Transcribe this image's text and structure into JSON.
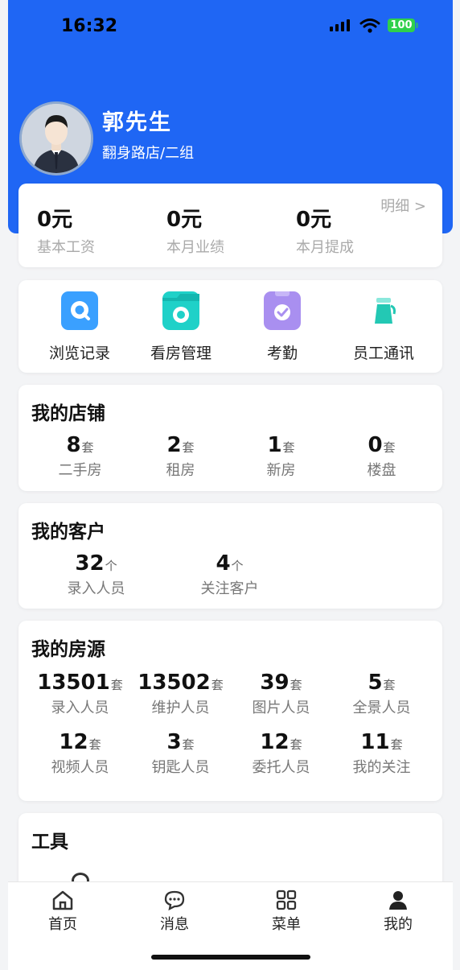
{
  "status_bar": {
    "time": "16:32",
    "battery": "100"
  },
  "profile": {
    "name": "郭先生",
    "store": "翻身路店/二组"
  },
  "salary": {
    "detail_label": "明细 >",
    "items": [
      {
        "value": "0元",
        "label": "基本工资"
      },
      {
        "value": "0元",
        "label": "本月业绩"
      },
      {
        "value": "0元",
        "label": "本月提成"
      }
    ]
  },
  "quick_actions": [
    {
      "label": "浏览记录",
      "icon": "search-bubble-icon",
      "color": "#3aa0ff"
    },
    {
      "label": "看房管理",
      "icon": "folder-camera-icon",
      "color": "#1fd1c8"
    },
    {
      "label": "考勤",
      "icon": "clipboard-check-icon",
      "color": "#a98ff0"
    },
    {
      "label": "员工通讯",
      "icon": "tie-icon",
      "color": "#23c8b4"
    }
  ],
  "shops": {
    "title": "我的店铺",
    "items": [
      {
        "value": "8",
        "unit": "套",
        "label": "二手房"
      },
      {
        "value": "2",
        "unit": "套",
        "label": "租房"
      },
      {
        "value": "1",
        "unit": "套",
        "label": "新房"
      },
      {
        "value": "0",
        "unit": "套",
        "label": "楼盘"
      }
    ]
  },
  "customers": {
    "title": "我的客户",
    "items": [
      {
        "value": "32",
        "unit": "个",
        "label": "录入人员"
      },
      {
        "value": "4",
        "unit": "个",
        "label": "关注客户"
      }
    ]
  },
  "houses": {
    "title": "我的房源",
    "items": [
      {
        "value": "13501",
        "unit": "套",
        "label": "录入人员"
      },
      {
        "value": "13502",
        "unit": "套",
        "label": "维护人员"
      },
      {
        "value": "39",
        "unit": "套",
        "label": "图片人员"
      },
      {
        "value": "5",
        "unit": "套",
        "label": "全景人员"
      },
      {
        "value": "12",
        "unit": "套",
        "label": "视频人员"
      },
      {
        "value": "3",
        "unit": "套",
        "label": "钥匙人员"
      },
      {
        "value": "12",
        "unit": "套",
        "label": "委托人员"
      },
      {
        "value": "11",
        "unit": "套",
        "label": "我的关注"
      }
    ]
  },
  "tools": {
    "title": "工具"
  },
  "tabbar": [
    {
      "label": "首页",
      "icon": "home-icon"
    },
    {
      "label": "消息",
      "icon": "chat-bubble-icon"
    },
    {
      "label": "菜单",
      "icon": "grid-menu-icon"
    },
    {
      "label": "我的",
      "icon": "person-icon"
    }
  ]
}
